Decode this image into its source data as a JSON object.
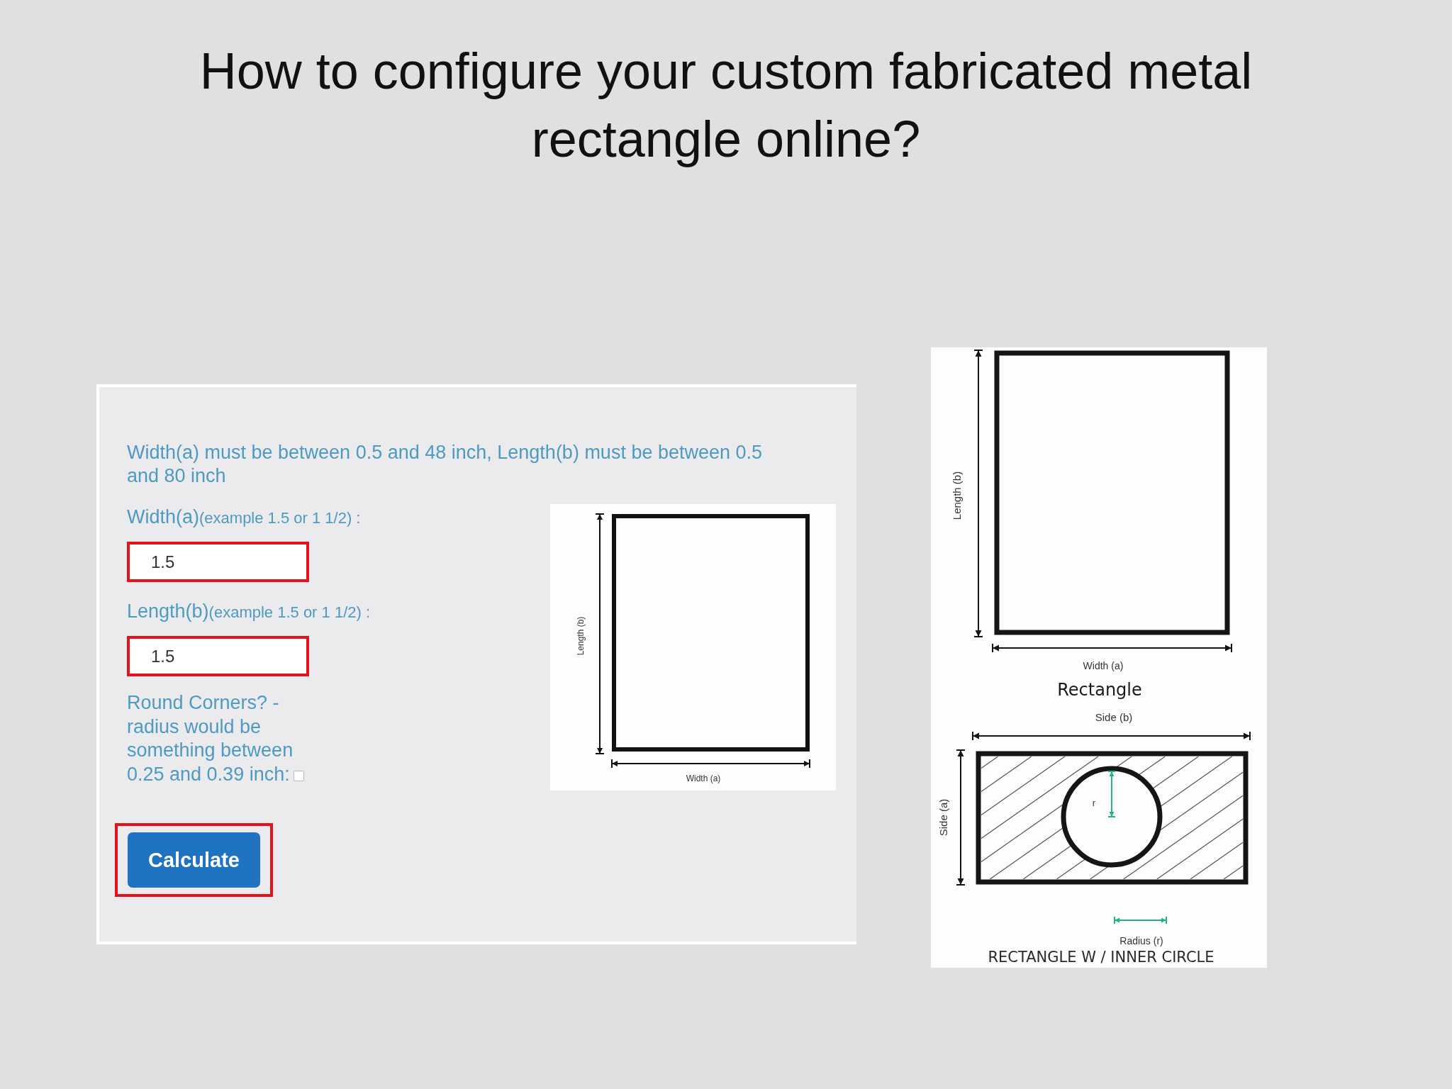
{
  "slide": {
    "title": "How to configure your custom fabricated metal rectangle online?"
  },
  "form": {
    "notice": "Width(a) must be between 0.5 and 48 inch, Length(b) must be between 0.5 and 80 inch",
    "fields": [
      {
        "label": "Width(a)",
        "example": "(example 1.5 or 1 1/2) :",
        "value": "1.5",
        "highlighted": true
      },
      {
        "label": "Length(b)",
        "example": "(example 1.5 or 1 1/2) :",
        "value": "1.5",
        "highlighted": true
      }
    ],
    "round_corners": {
      "label": "Round Corners? - radius would be something between 0.25 and 0.39 inch:",
      "checked": false
    },
    "calculate_button": {
      "label": "Calculate",
      "highlighted": true
    },
    "diagram": {
      "length_label": "Length (b)",
      "width_label": "Width (a)"
    }
  },
  "reference_diagrams": {
    "rectangle": {
      "length_label": "Length (b)",
      "width_label": "Width (a)",
      "caption": "Rectangle"
    },
    "inner_circle": {
      "side_b_label": "Side (b)",
      "side_a_label": "Side (a)",
      "radius_mark": "r",
      "radius_label": "Radius (r)",
      "caption": "RECTANGLE W / INNER CIRCLE"
    }
  }
}
